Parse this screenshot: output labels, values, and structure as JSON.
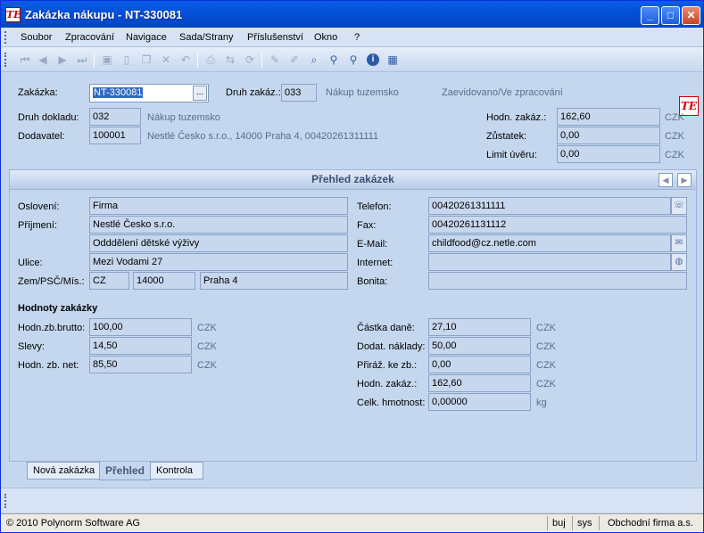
{
  "window": {
    "title": "Zakázka nákupu - NT-330081",
    "logo_text": "TE"
  },
  "menu": [
    "Soubor",
    "Zpracování",
    "Navigace",
    "Sada/Strany",
    "Příslušenství",
    "Okno",
    "?"
  ],
  "toolbar_icons": [
    "first-icon",
    "prev-icon",
    "next-icon",
    "last-icon",
    "save-icon",
    "new-icon",
    "copy-icon",
    "delete-icon",
    "undo-icon",
    "print-icon",
    "transfer-icon",
    "refresh-icon",
    "edit-icon",
    "edit2-icon",
    "search-icon",
    "zoom-icon",
    "find-icon",
    "info-icon",
    "calculator-icon"
  ],
  "header": {
    "zakazka_label": "Zakázka:",
    "zakazka_value": "NT-330081",
    "druh_zakaz_label": "Druh zakáz.:",
    "druh_zakaz_value": "033",
    "druh_zakaz_text": "Nákup tuzemsko",
    "status": "Zaevidovano/Ve zpracování",
    "druh_dokladu_label": "Druh dokladu:",
    "druh_dokladu_value": "032",
    "druh_dokladu_text": "Nákup tuzemsko",
    "dodavatel_label": "Dodavatel:",
    "dodavatel_value": "100001",
    "dodavatel_text": "Nestlé Česko s.r.o., 14000 Praha 4, 00420261311111",
    "hodn_zakaz_label": "Hodn. zakáz.:",
    "hodn_zakaz_value": "162,60",
    "zustatek_label": "Zůstatek:",
    "zustatek_value": "0,00",
    "limit_label": "Limit úvěru:",
    "limit_value": "0,00",
    "currency": "CZK"
  },
  "panel": {
    "title": "Přehled zakázek",
    "osloveni_label": "Oslovení:",
    "osloveni_value": "Firma",
    "prijmeni_label": "Příjmení:",
    "prijmeni_value": "Nestlé Česko s.r.o.",
    "oddeleni_value": "Odddělení dětské výživy",
    "ulice_label": "Ulice:",
    "ulice_value": "Mezi Vodami 27",
    "zem_label": "Zem/PSČ/Mís.:",
    "zem_value": "CZ",
    "psc_value": "14000",
    "misto_value": "Praha 4",
    "telefon_label": "Telefon:",
    "telefon_value": "00420261311111",
    "fax_label": "Fax:",
    "fax_value": "00420261131112",
    "email_label": "E-Mail:",
    "email_value": "childfood@cz.netle.com",
    "internet_label": "Internet:",
    "internet_value": "",
    "bonita_label": "Bonita:",
    "bonita_value": "",
    "section_title": "Hodnoty zakázky",
    "brutto_label": "Hodn.zb.brutto:",
    "brutto_value": "100,00",
    "slevy_label": "Slevy:",
    "slevy_value": "14,50",
    "net_label": "Hodn. zb. net:",
    "net_value": "85,50",
    "dan_label": "Částka daně:",
    "dan_value": "27,10",
    "naklady_label": "Dodat. náklady:",
    "naklady_value": "50,00",
    "priraz_label": "Přiráž. ke zb.:",
    "priraz_value": "0,00",
    "hodn_label": "Hodn. zakáz.:",
    "hodn_value": "162,60",
    "hmotnost_label": "Celk. hmotnost:",
    "hmotnost_value": "0,00000",
    "unit_kg": "kg",
    "currency": "CZK"
  },
  "tabs": [
    "Nová zakázka",
    "Přehled",
    "Kontrola"
  ],
  "status": {
    "copyright": "© 2010 Polynorm Software AG",
    "user": "buj",
    "system": "sys",
    "company": "Obchodní firma a.s."
  }
}
